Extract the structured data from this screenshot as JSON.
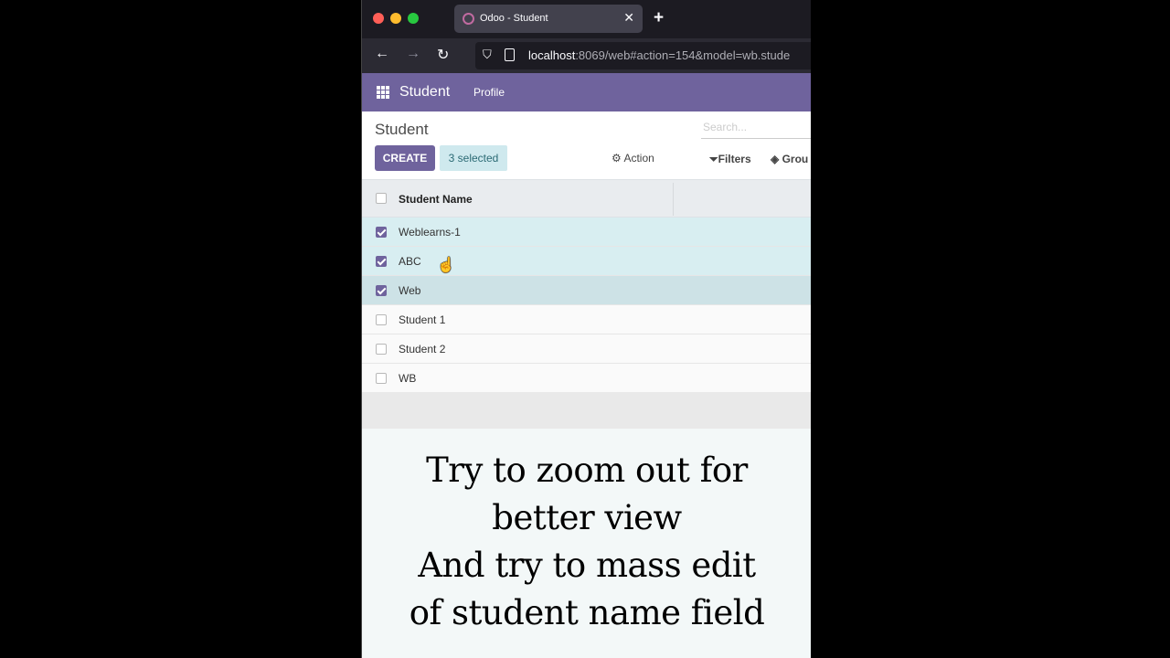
{
  "browser": {
    "tab_title": "Odoo - Student",
    "tab_close": "✕",
    "new_tab": "+",
    "url_host": "localhost",
    "url_rest": ":8069/web#action=154&model=wb.stude"
  },
  "odoo": {
    "app_name": "Student",
    "menu_profile": "Profile"
  },
  "control_panel": {
    "breadcrumb": "Student",
    "search_placeholder": "Search...",
    "create_label": "CREATE",
    "selected_label": "3 selected",
    "action_label": "Action",
    "filters_label": "Filters",
    "groupby_label": "Grou"
  },
  "list": {
    "column_header": "Student Name",
    "rows": [
      {
        "name": "Weblearns-1",
        "checked": true
      },
      {
        "name": "ABC",
        "checked": true
      },
      {
        "name": "Web",
        "checked": true
      },
      {
        "name": "Student 1",
        "checked": false
      },
      {
        "name": "Student 2",
        "checked": false
      },
      {
        "name": "WB",
        "checked": false
      }
    ]
  },
  "caption": {
    "line1": "Try to zoom out for",
    "line2": "better view",
    "line3": "And try to mass edit",
    "line4": "of student name field"
  },
  "colors": {
    "odoo_purple": "#6f639d",
    "selected_row": "#d8eef1"
  }
}
